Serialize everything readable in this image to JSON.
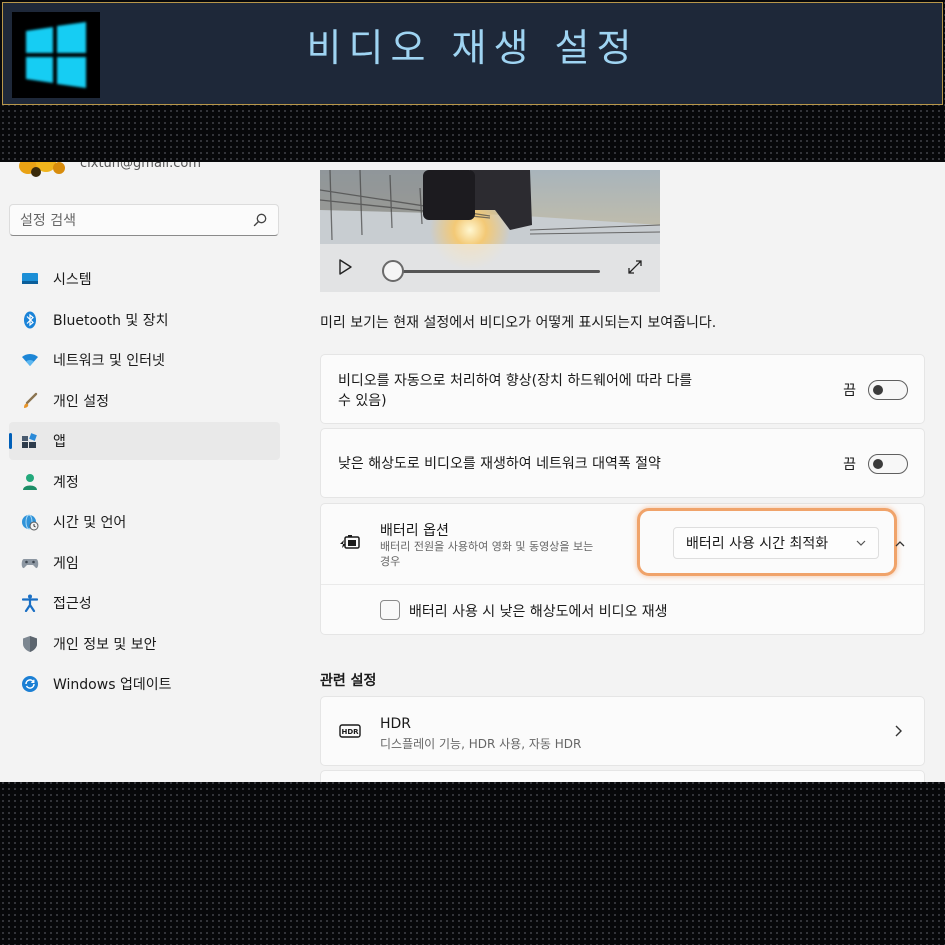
{
  "banner": {
    "title": "비디오 재생 설정",
    "logo_icon": "windows-logo-icon"
  },
  "account": {
    "email": "cixtun@gmail.com"
  },
  "search": {
    "placeholder": "설정 검색",
    "icon": "search-icon"
  },
  "sidebar": {
    "items": [
      {
        "label": "시스템",
        "icon": "monitor-icon"
      },
      {
        "label": "Bluetooth 및 장치",
        "icon": "bluetooth-icon"
      },
      {
        "label": "네트워크 및 인터넷",
        "icon": "wifi-icon"
      },
      {
        "label": "개인 설정",
        "icon": "brush-icon"
      },
      {
        "label": "앱",
        "icon": "apps-icon",
        "active": true
      },
      {
        "label": "계정",
        "icon": "person-icon"
      },
      {
        "label": "시간 및 언어",
        "icon": "globe-clock-icon"
      },
      {
        "label": "게임",
        "icon": "gamepad-icon"
      },
      {
        "label": "접근성",
        "icon": "accessibility-icon"
      },
      {
        "label": "개인 정보 및 보안",
        "icon": "shield-icon"
      },
      {
        "label": "Windows 업데이트",
        "icon": "update-icon"
      }
    ]
  },
  "preview": {
    "caption": "미리 보기는 현재 설정에서 비디오가 어떻게 표시되는지 보여줍니다.",
    "seek_progress": 0
  },
  "settings": {
    "auto_enhance": {
      "label_line1": "비디오를 자동으로 처리하여 향상(장치 하드웨어에 따라 다를",
      "label_line2": "수 있음)",
      "state": "끔"
    },
    "low_res_network": {
      "label": "낮은 해상도로 비디오를 재생하여 네트워크 대역폭 절약",
      "state": "끔"
    },
    "battery": {
      "title": "배터리 옵션",
      "subtitle_line1": "배터리 전원을 사용하여 영화 및 동영상을 보는",
      "subtitle_line2": "경우",
      "dropdown_value": "배터리 사용 시간 최적화",
      "checkbox_label": "배터리 사용 시 낮은 해상도에서 비디오 재생",
      "checkbox_checked": false
    }
  },
  "related": {
    "heading": "관련 설정",
    "hdr": {
      "title": "HDR",
      "subtitle": "디스플레이 기능, HDR 사용, 자동 HDR"
    }
  },
  "colors": {
    "accent": "#005fb8",
    "highlight": "#f0a36a",
    "banner_bg": "#1e2839",
    "banner_text": "#9fd4f2"
  }
}
